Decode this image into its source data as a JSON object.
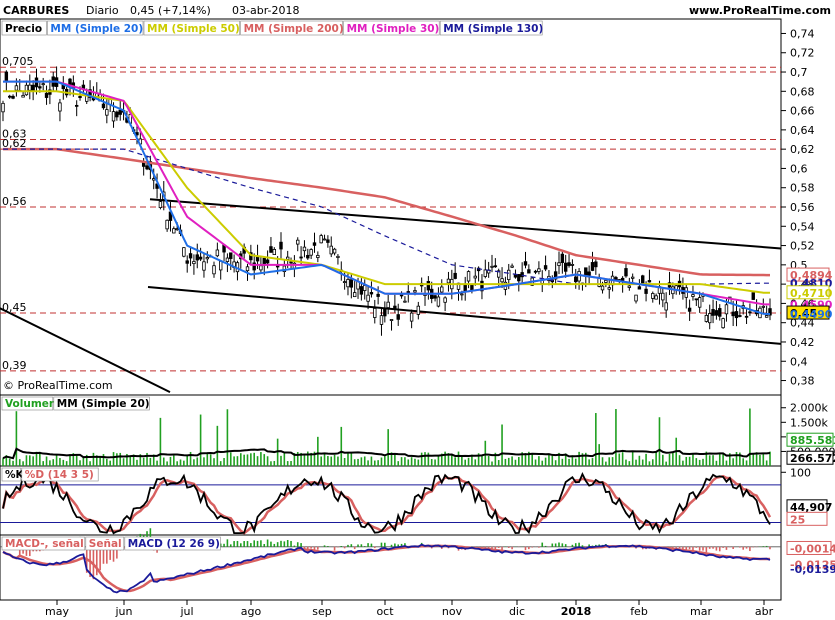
{
  "header": {
    "symbol": "CARBURES",
    "period": "Diario",
    "price_change": "0,45 (+7,14%)",
    "date": "03-abr-2018",
    "site": "www.ProRealTime.com"
  },
  "watermark": "© ProRealTime.com",
  "price_panel": {
    "legend": [
      {
        "label": "Precio",
        "color": "#000000"
      },
      {
        "label": "MM (Simple 20)",
        "color": "#1e6ee6"
      },
      {
        "label": "MM (Simple 50)",
        "color": "#cccc00"
      },
      {
        "label": "MM (Simple 200)",
        "color": "#d86060"
      },
      {
        "label": "MM (Simple 30)",
        "color": "#e020c0"
      },
      {
        "label": "MM (Simple 130)",
        "color": "#1a1a9a"
      }
    ],
    "ylim": [
      0.365,
      0.755
    ],
    "yticks": [
      "0,74",
      "0,72",
      "0,7",
      "0,68",
      "0,66",
      "0,64",
      "0,62",
      "0,6",
      "0,58",
      "0,56",
      "0,54",
      "0,52",
      "0,5",
      "0,48",
      "0,46",
      "0,44",
      "0,42",
      "0,4",
      "0,38"
    ],
    "tick_values": [
      0.74,
      0.72,
      0.7,
      0.68,
      0.66,
      0.64,
      0.62,
      0.6,
      0.58,
      0.56,
      0.54,
      0.52,
      0.5,
      0.48,
      0.46,
      0.44,
      0.42,
      0.4,
      0.38
    ],
    "hlines": [
      {
        "value": 0.705,
        "label": "0,705"
      },
      {
        "value": 0.7,
        "label": ""
      },
      {
        "value": 0.63,
        "label": "0,63"
      },
      {
        "value": 0.62,
        "label": "0,62"
      },
      {
        "value": 0.56,
        "label": "0,56"
      },
      {
        "value": 0.45,
        "label": "0,45"
      },
      {
        "value": 0.39,
        "label": "0,39"
      }
    ],
    "right_labels": [
      {
        "text": "0,4894",
        "value": 0.4894,
        "color": "#d86060",
        "boxed": true
      },
      {
        "text": "0,4810",
        "value": 0.481,
        "color": "#1a1a9a",
        "boxed": false
      },
      {
        "text": "0,4710",
        "value": 0.471,
        "color": "#cccc00",
        "boxed": true
      },
      {
        "text": "0,4590",
        "value": 0.459,
        "color": "#e020c0",
        "boxed": false
      },
      {
        "text": "0,45",
        "value": 0.45,
        "color": "#000000",
        "boxed": true,
        "fill": "#ffe000"
      },
      {
        "text": "0,4490",
        "value": 0.449,
        "color": "#1e6ee6",
        "boxed": false
      }
    ]
  },
  "volume_panel": {
    "legend": [
      {
        "label": "Volumen",
        "color": "#20a020"
      },
      {
        "label": "MM (Simple 20)",
        "color": "#000000"
      }
    ],
    "yticks": [
      "2.000k",
      "1.500k",
      "1.000k",
      "500.000"
    ],
    "tick_values": [
      2000000,
      1500000,
      1000000,
      500000
    ],
    "ylim": [
      0,
      2300000
    ],
    "right_labels": [
      {
        "text": "885.581",
        "value": 885581,
        "color": "#20a020",
        "boxed": true
      },
      {
        "text": "266.572",
        "value": 266572,
        "color": "#000000",
        "boxed": true
      }
    ]
  },
  "stoch_panel": {
    "legend": [
      {
        "label": "%K",
        "color": "#000000"
      },
      {
        "label": "%D (14 3 5)",
        "color": "#d86060"
      }
    ],
    "yticks": [
      "100"
    ],
    "tick_values": [
      100
    ],
    "ylim": [
      0,
      110
    ],
    "levels": [
      {
        "value": 80,
        "color": "#1a1a9a"
      },
      {
        "value": 20,
        "color": "#1a1a9a"
      }
    ],
    "right_labels": [
      {
        "text": "44,907",
        "value": 44.907,
        "color": "#000000",
        "boxed": true
      },
      {
        "text": "25",
        "value": 25,
        "color": "#d86060",
        "boxed": true
      }
    ]
  },
  "macd_panel": {
    "legend": [
      {
        "label": "MACD-, señal",
        "color": "#d86060"
      },
      {
        "label": "Señal",
        "color": "#d86060"
      },
      {
        "label": "MACD (12 26 9)",
        "color": "#1a1a9a"
      }
    ],
    "ylim": [
      -0.045,
      0.01
    ],
    "right_labels": [
      {
        "text": "-0,0014",
        "value": -0.0014,
        "color": "#d86060",
        "boxed": true
      },
      {
        "text": "-0,0125",
        "value": -0.0125,
        "color": "#d86060",
        "boxed": false
      },
      {
        "text": "-0,0139",
        "value": -0.0139,
        "color": "#1a1a9a",
        "boxed": false
      }
    ]
  },
  "xaxis": {
    "labels": [
      "may",
      "jun",
      "jul",
      "ago",
      "sep",
      "oct",
      "nov",
      "dic",
      "2018",
      "feb",
      "mar",
      "abr"
    ]
  },
  "chart_data": {
    "type": "candlestick",
    "x": [
      "may",
      "jun",
      "jul",
      "ago",
      "sep",
      "oct",
      "nov",
      "dic",
      "2018",
      "feb",
      "mar",
      "abr"
    ],
    "series": [
      {
        "name": "Precio",
        "values": [
          0.68,
          0.66,
          0.51,
          0.5,
          0.52,
          0.45,
          0.48,
          0.49,
          0.49,
          0.48,
          0.46,
          0.45
        ]
      },
      {
        "name": "MM (Simple 20)",
        "values": [
          0.69,
          0.66,
          0.52,
          0.49,
          0.5,
          0.47,
          0.47,
          0.48,
          0.49,
          0.48,
          0.47,
          0.449
        ]
      },
      {
        "name": "MM (Simple 50)",
        "values": [
          0.68,
          0.67,
          0.58,
          0.51,
          0.5,
          0.48,
          0.48,
          0.48,
          0.48,
          0.48,
          0.48,
          0.471
        ]
      },
      {
        "name": "MM (Simple 200)",
        "values": [
          0.62,
          0.61,
          0.6,
          0.59,
          0.58,
          0.57,
          0.55,
          0.53,
          0.51,
          0.5,
          0.49,
          0.4894
        ]
      },
      {
        "name": "MM (Simple 30)",
        "values": [
          0.69,
          0.67,
          0.55,
          0.5,
          0.5,
          0.47,
          0.47,
          0.48,
          0.49,
          0.48,
          0.47,
          0.459
        ]
      },
      {
        "name": "MM (Simple 130)",
        "values": [
          0.62,
          0.62,
          0.6,
          0.58,
          0.56,
          0.53,
          0.5,
          0.49,
          0.48,
          0.48,
          0.48,
          0.481
        ]
      }
    ],
    "ylim": [
      0.365,
      0.755
    ]
  }
}
